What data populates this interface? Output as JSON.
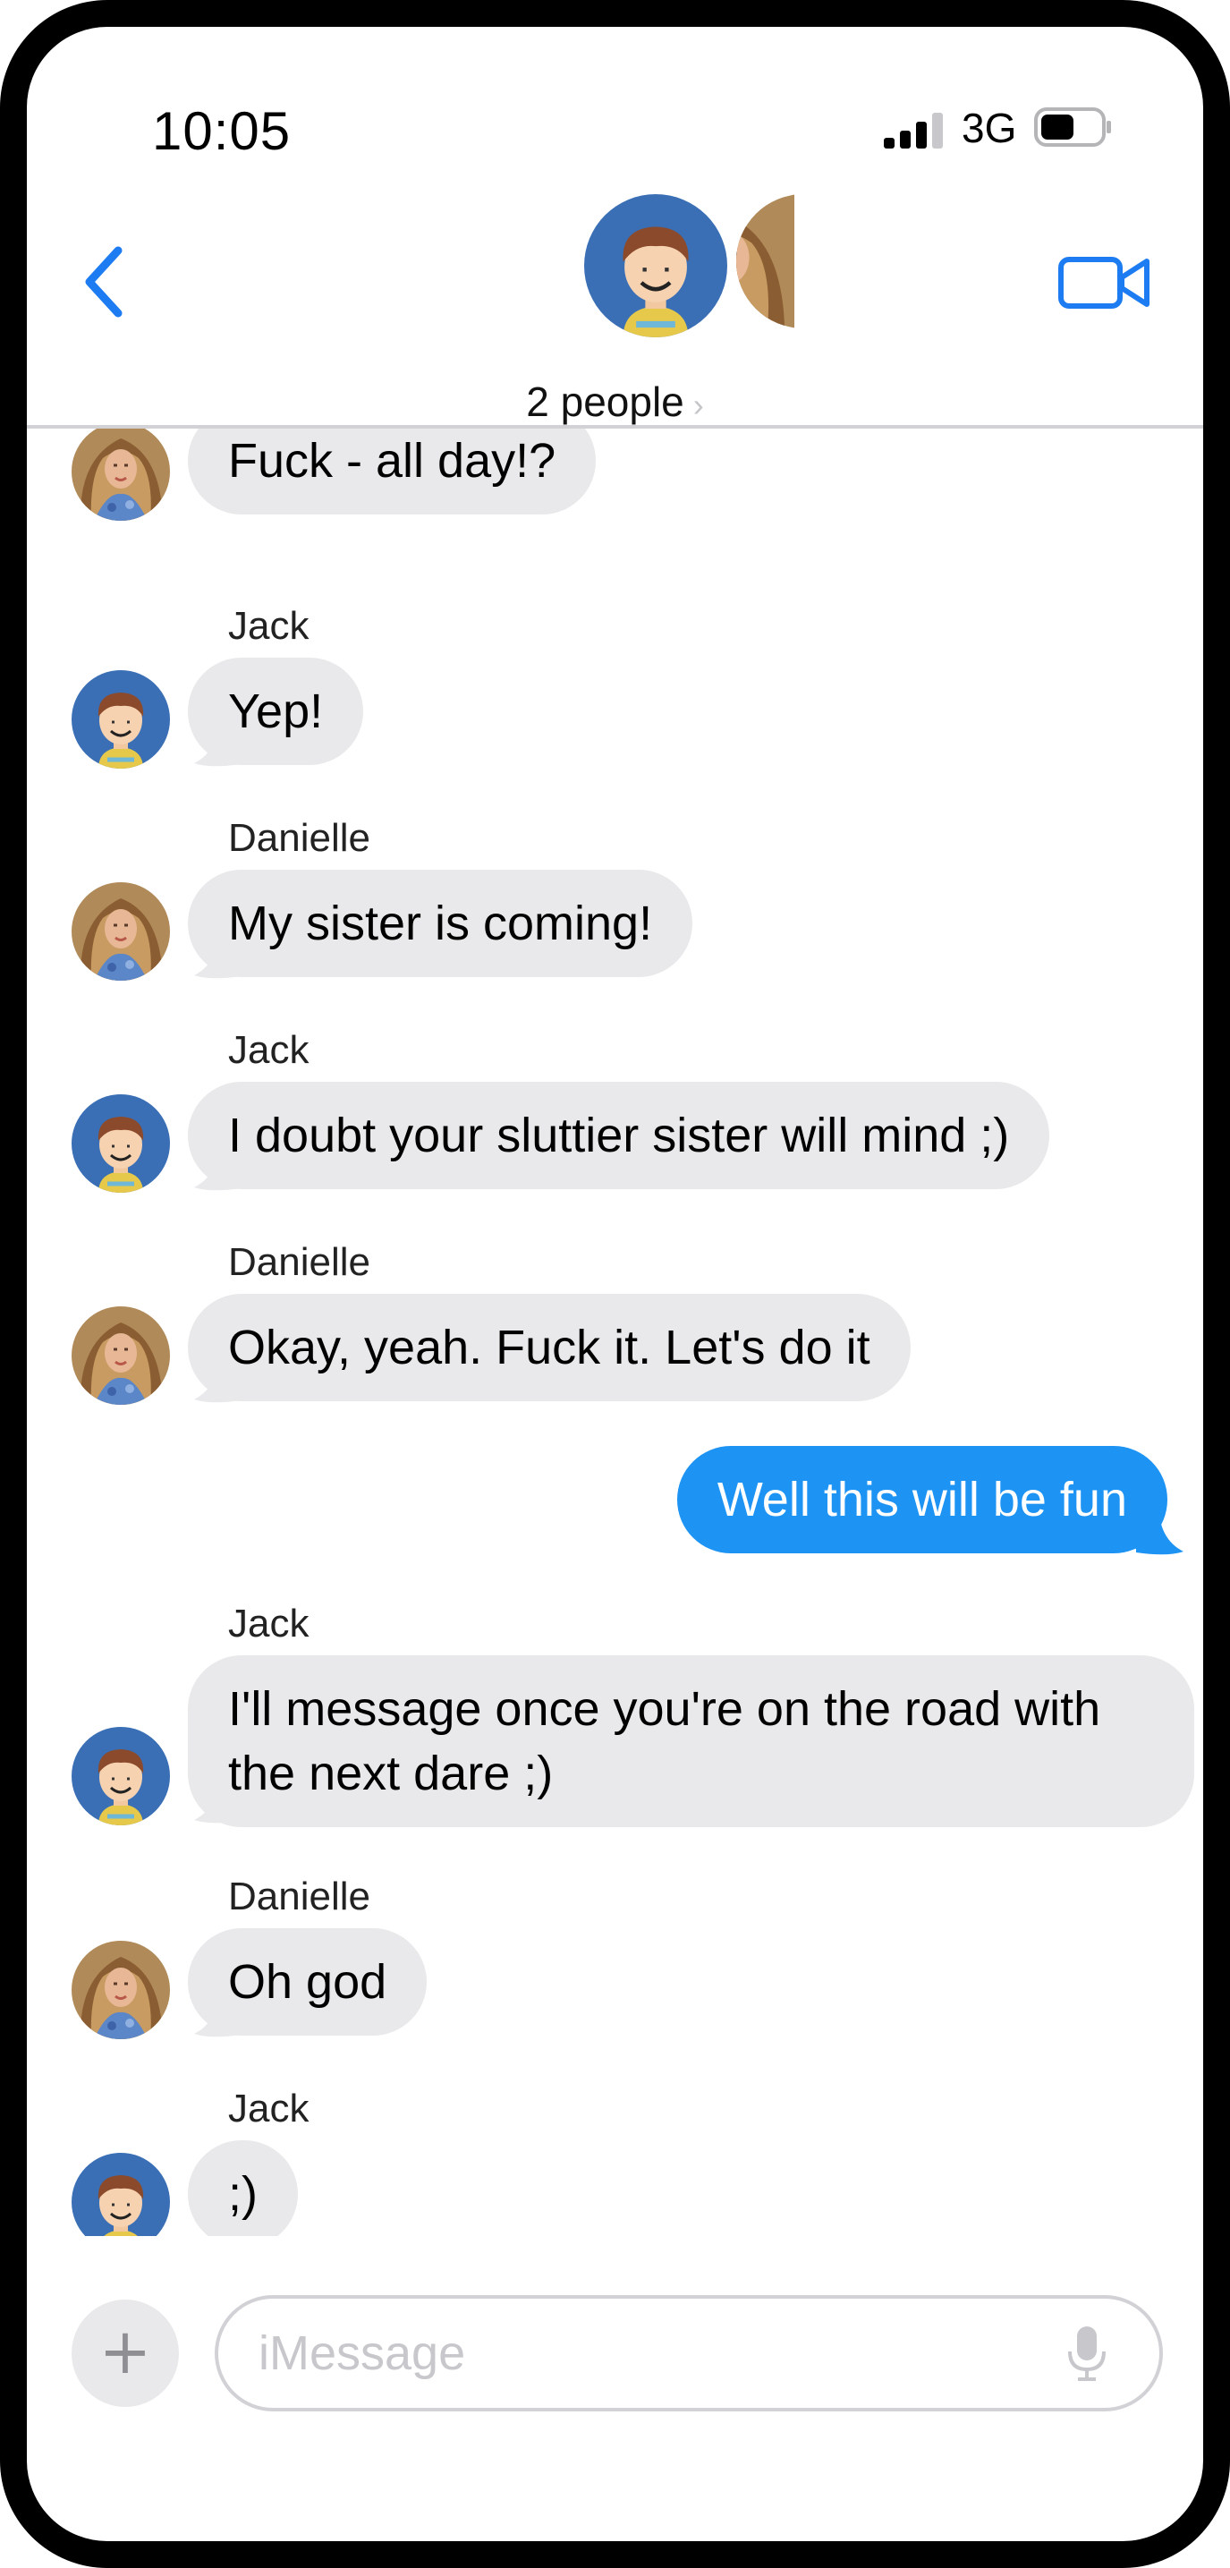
{
  "status_bar": {
    "time": "10:05",
    "network": "3G"
  },
  "header": {
    "group_label": "2 people",
    "chevron": "›"
  },
  "icons": {
    "back": "chevron-left-icon",
    "video": "video-camera-icon",
    "plus": "plus-icon",
    "mic": "microphone-icon"
  },
  "colors": {
    "accent": "#1d93f4",
    "incoming_bubble": "#e9e9eb",
    "avatar_jack_bg": "#3a6fb5"
  },
  "messages": [
    {
      "sender": "",
      "avatar": "danielle",
      "text": "Fuck - all day!?"
    },
    {
      "sender": "Jack",
      "avatar": "jack",
      "text": "Yep!"
    },
    {
      "sender": "Danielle",
      "avatar": "danielle",
      "text": "My sister is coming!"
    },
    {
      "sender": "Jack",
      "avatar": "jack",
      "text": "I doubt your sluttier sister will mind ;)"
    },
    {
      "sender": "Danielle",
      "avatar": "danielle",
      "text": "Okay, yeah.  Fuck it.  Let's do it"
    },
    {
      "sender": "me",
      "text": "Well this will be fun"
    },
    {
      "sender": "Jack",
      "avatar": "jack",
      "text": "I'll message once you're on the road with the next dare ;)"
    },
    {
      "sender": "Danielle",
      "avatar": "danielle",
      "text": "Oh god"
    },
    {
      "sender": "Jack",
      "avatar": "jack",
      "text": ";)"
    }
  ],
  "composer": {
    "placeholder": "iMessage",
    "plus": "+"
  }
}
